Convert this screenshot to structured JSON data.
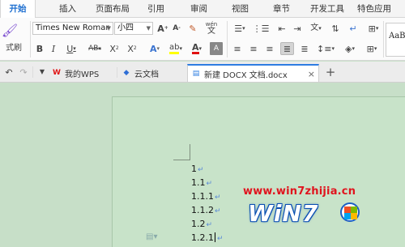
{
  "menu": {
    "tabs": [
      "开始",
      "插入",
      "页面布局",
      "引用",
      "审阅",
      "视图",
      "章节",
      "开发工具",
      "特色应用"
    ]
  },
  "ribbon": {
    "format_painter_label": "式刷",
    "font_name": "Times New Romar",
    "font_size": "小四",
    "phonetic": "wén",
    "style_preview": "AaBb",
    "colors": {
      "highlight": "#ffff00",
      "font_color": "#e01010"
    }
  },
  "doc_tabs": {
    "items": [
      {
        "label": "我的WPS"
      },
      {
        "label": "云文档"
      },
      {
        "label": "新建 DOCX 文档.docx"
      }
    ],
    "close": "×",
    "add": "+"
  },
  "document": {
    "lines": [
      "1",
      "1.1",
      "1.1.1",
      "1.1.2",
      "1.2",
      "1.2.1"
    ],
    "paragraph_mark": "↵"
  },
  "watermark": {
    "url": "www.win7zhijia.cn",
    "logo": "WiN7"
  }
}
